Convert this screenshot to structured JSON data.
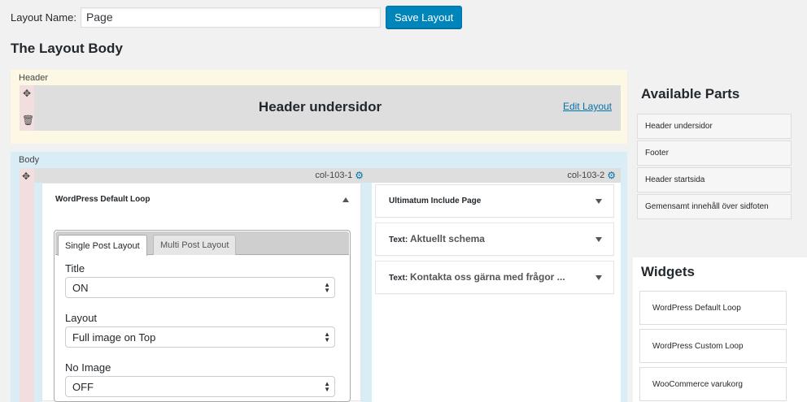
{
  "layout_name": {
    "label": "Layout Name:",
    "value": "Page"
  },
  "save_button": "Save Layout",
  "body_title": "The Layout Body",
  "header_section": {
    "label": "Header",
    "part_title": "Header undersidor",
    "edit_link": "Edit Layout"
  },
  "body_section": {
    "label": "Body",
    "columns": [
      {
        "name": "col-103-1"
      },
      {
        "name": "col-103-2"
      }
    ],
    "col1_widget": {
      "title": "WordPress Default Loop",
      "tabs": [
        "Single Post Layout",
        "Multi Post Layout"
      ],
      "fields": [
        {
          "label": "Title",
          "value": "ON"
        },
        {
          "label": "Layout",
          "value": "Full image on Top"
        },
        {
          "label": "No Image",
          "value": "OFF"
        }
      ]
    },
    "col2_widgets": [
      {
        "prefix": "",
        "title": "Ultimatum Include Page"
      },
      {
        "prefix": "Text:",
        "title": "Aktuellt schema"
      },
      {
        "prefix": "Text:",
        "title": "Kontakta oss gärna med frågor ..."
      }
    ]
  },
  "available_parts": {
    "title": "Available Parts",
    "items": [
      "Header undersidor",
      "Footer",
      "Header startsida",
      "Gemensamt innehåll över sidfoten"
    ]
  },
  "widgets": {
    "title": "Widgets",
    "items": [
      "WordPress Default Loop",
      "WordPress Custom Loop",
      "WooCommerce varukorg"
    ]
  },
  "colors": {
    "accent": "#0085ba",
    "header_bg": "#fcf8e3",
    "body_bg": "#d9edf7",
    "handle_bg": "#f2dede"
  }
}
